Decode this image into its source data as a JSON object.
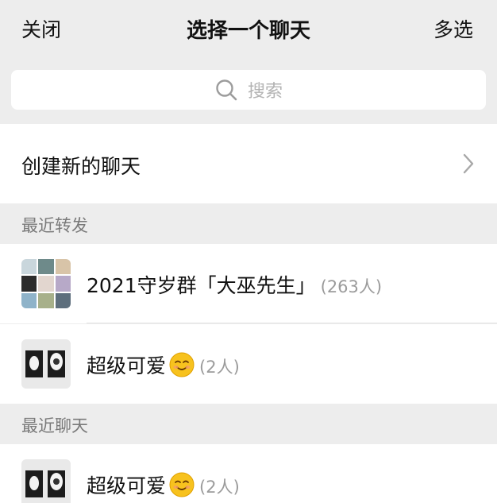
{
  "header": {
    "close_label": "关闭",
    "title": "选择一个聊天",
    "multi_select_label": "多选"
  },
  "search": {
    "placeholder": "搜索",
    "icon": "search-icon"
  },
  "new_chat": {
    "label": "创建新的聊天",
    "icon": "chevron-right-icon"
  },
  "recent_forward": {
    "section_label": "最近转发",
    "items": [
      {
        "name": "2021守岁群「大巫先生」",
        "count": "(263人)"
      },
      {
        "name": "超级可爱",
        "count": "(2人)",
        "emoji": "smiling-face-emoji"
      }
    ]
  },
  "recent_chats": {
    "section_label": "最近聊天",
    "items": [
      {
        "name": "超级可爱",
        "count": "(2人)",
        "emoji": "smiling-face-emoji"
      }
    ]
  },
  "colors": {
    "background": "#ededed",
    "row": "#ffffff",
    "muted_text": "#7a7a7a",
    "count_text": "#9b9b9b"
  }
}
